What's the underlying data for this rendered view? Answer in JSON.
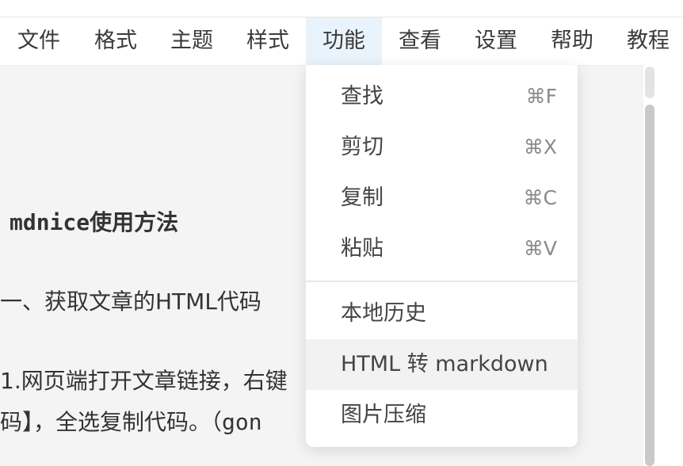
{
  "menubar": {
    "items": [
      {
        "label": "文件"
      },
      {
        "label": "格式"
      },
      {
        "label": "主题"
      },
      {
        "label": "样式"
      },
      {
        "label": "功能",
        "active": true
      },
      {
        "label": "查看"
      },
      {
        "label": "设置"
      },
      {
        "label": "帮助"
      },
      {
        "label": "教程"
      }
    ]
  },
  "dropdown": {
    "items": [
      {
        "label": "查找",
        "shortcut": "⌘F"
      },
      {
        "label": "剪切",
        "shortcut": "⌘X"
      },
      {
        "label": "复制",
        "shortcut": "⌘C"
      },
      {
        "label": "粘贴",
        "shortcut": "⌘V"
      },
      {
        "label": "本地历史"
      },
      {
        "label": "HTML 转 markdown"
      },
      {
        "label": "图片压缩"
      }
    ]
  },
  "editor": {
    "lines": [
      "mdnice使用方法",
      "一、获取文章的HTML代码",
      "1.网页端打开文章链接，右键",
      "码】，全选复制代码。（gon"
    ]
  },
  "colors": {
    "active_menu_bg": "#e9f3fb",
    "editor_bg": "#f4f4f4",
    "hover_bg": "#f2f2f2"
  }
}
